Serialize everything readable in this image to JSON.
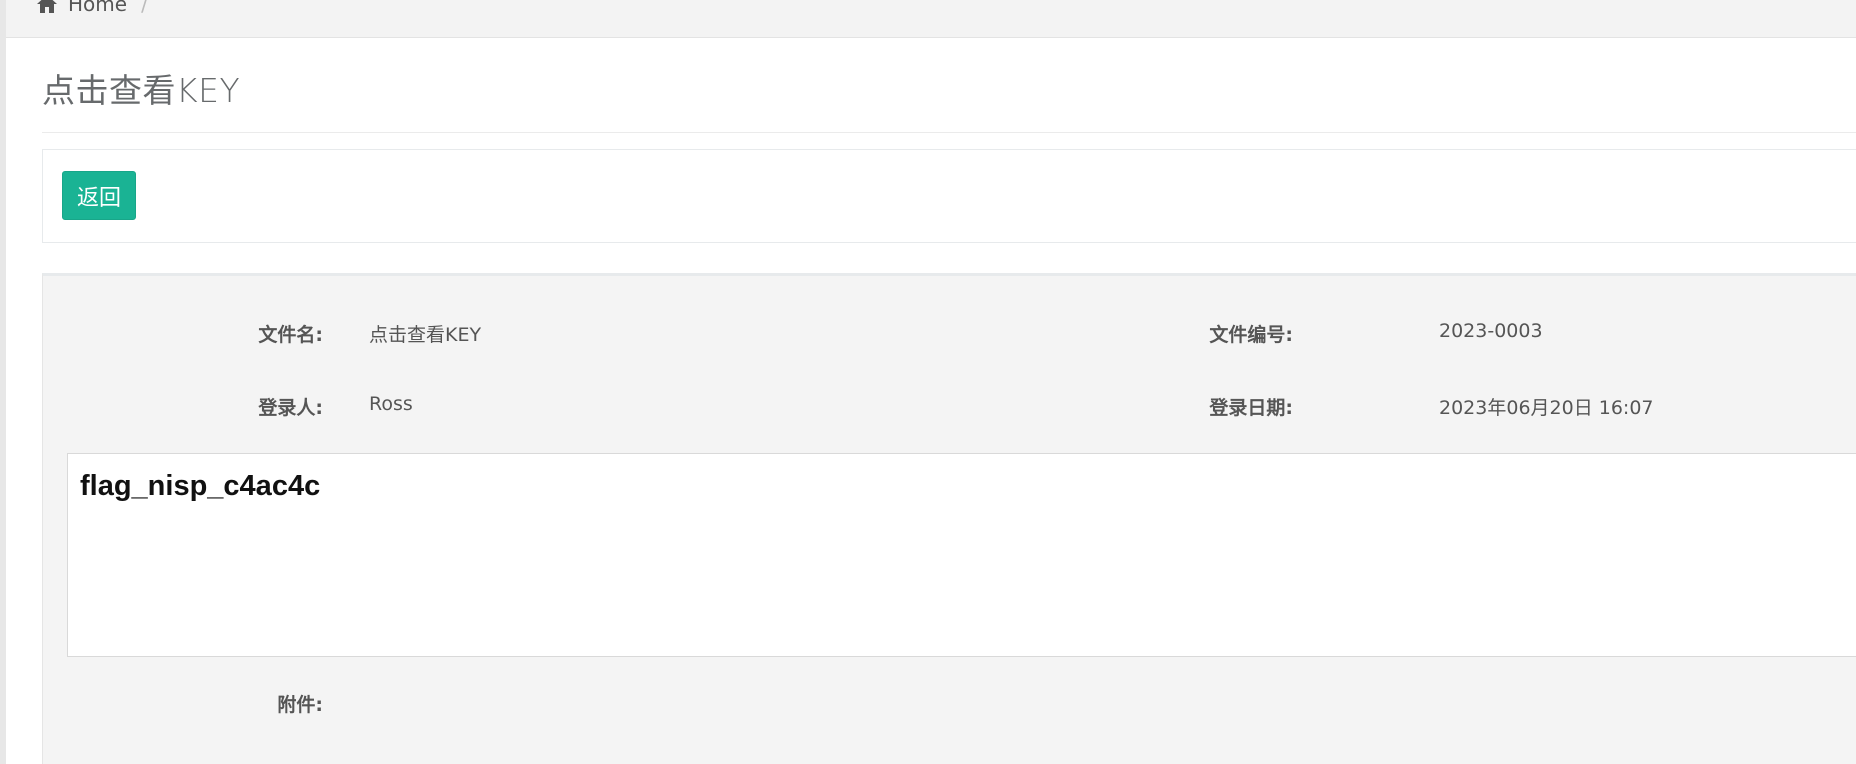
{
  "breadcrumb": {
    "home_label": "Home",
    "separator": "/"
  },
  "page": {
    "title": "点击查看KEY"
  },
  "actions": {
    "back_label": "返回"
  },
  "details": {
    "filename_label": "文件名:",
    "filename_value": "点击查看KEY",
    "file_number_label": "文件编号:",
    "file_number_value": "2023-0003",
    "registrant_label": "登录人:",
    "registrant_value": "Ross",
    "register_date_label": "登录日期:",
    "register_date_value": "2023年06月20日 16:07",
    "content_text": "flag_nisp_c4ac4c",
    "attachment_label": "附件:"
  },
  "colors": {
    "primary_button": "#1ab394",
    "panel_background": "#f4f4f4",
    "breadcrumb_background": "#f3f3f3"
  },
  "icons": {
    "breadcrumb_home": "home-icon"
  }
}
